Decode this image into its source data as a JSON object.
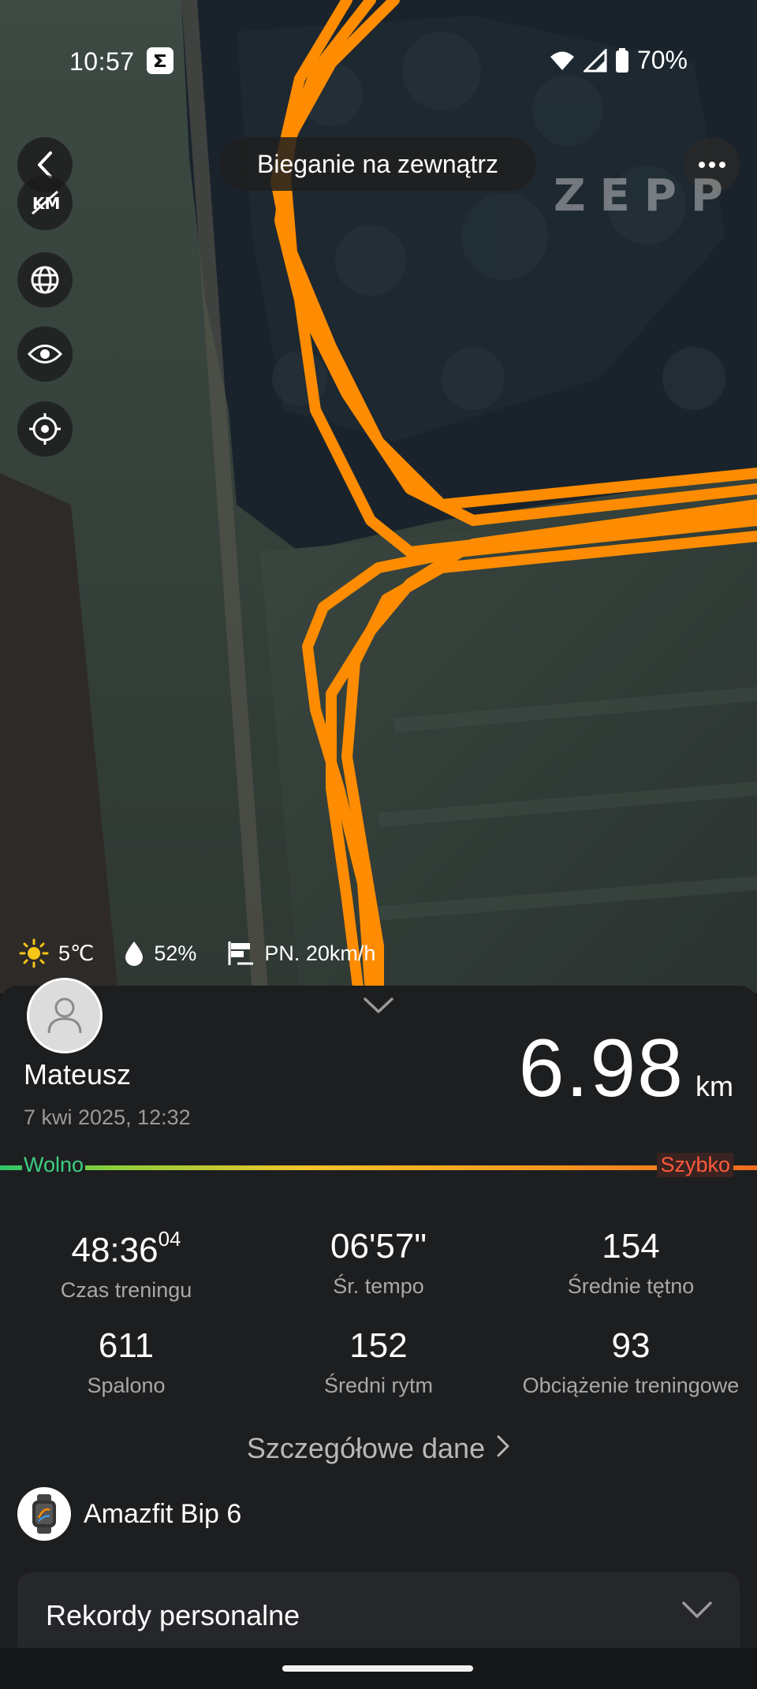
{
  "status_bar": {
    "time": "10:57",
    "battery": "70%",
    "icons": [
      "zepp-app-icon",
      "wifi-icon",
      "signal-icon",
      "battery-icon"
    ]
  },
  "header": {
    "title": "Bieganie na zewnątrz",
    "logo": "ZEPP"
  },
  "map_tools": [
    "hide-distance-icon",
    "globe-icon",
    "eye-icon",
    "locate-icon"
  ],
  "weather": {
    "temperature": "5℃",
    "humidity": "52%",
    "wind": "PN. 20km/h"
  },
  "summary": {
    "user_name": "Mateusz",
    "date": "7 kwi 2025, 12:32",
    "distance_value": "6.98",
    "distance_unit": "km"
  },
  "pace_scale": {
    "slow_label": "Wolno",
    "fast_label": "Szybko"
  },
  "stats": [
    {
      "value": "48:36",
      "sup": "04",
      "label": "Czas treningu"
    },
    {
      "value": "06'57\"",
      "label": "Śr. tempo"
    },
    {
      "value": "154",
      "label": "Średnie tętno"
    },
    {
      "value": "611",
      "label": "Spalono"
    },
    {
      "value": "152",
      "label": "Średni rytm"
    },
    {
      "value": "93",
      "label": "Obciążenie treningowe"
    }
  ],
  "details_link": "Szczegółowe dane",
  "device": {
    "name": "Amazfit Bip 6"
  },
  "records": {
    "title": "Rekordy personalne"
  },
  "colors": {
    "route": "#ff8c00",
    "pace_slow": "#3ccf82",
    "pace_fast": "#ff5a3c",
    "sheet_bg": "#1d1e20"
  }
}
